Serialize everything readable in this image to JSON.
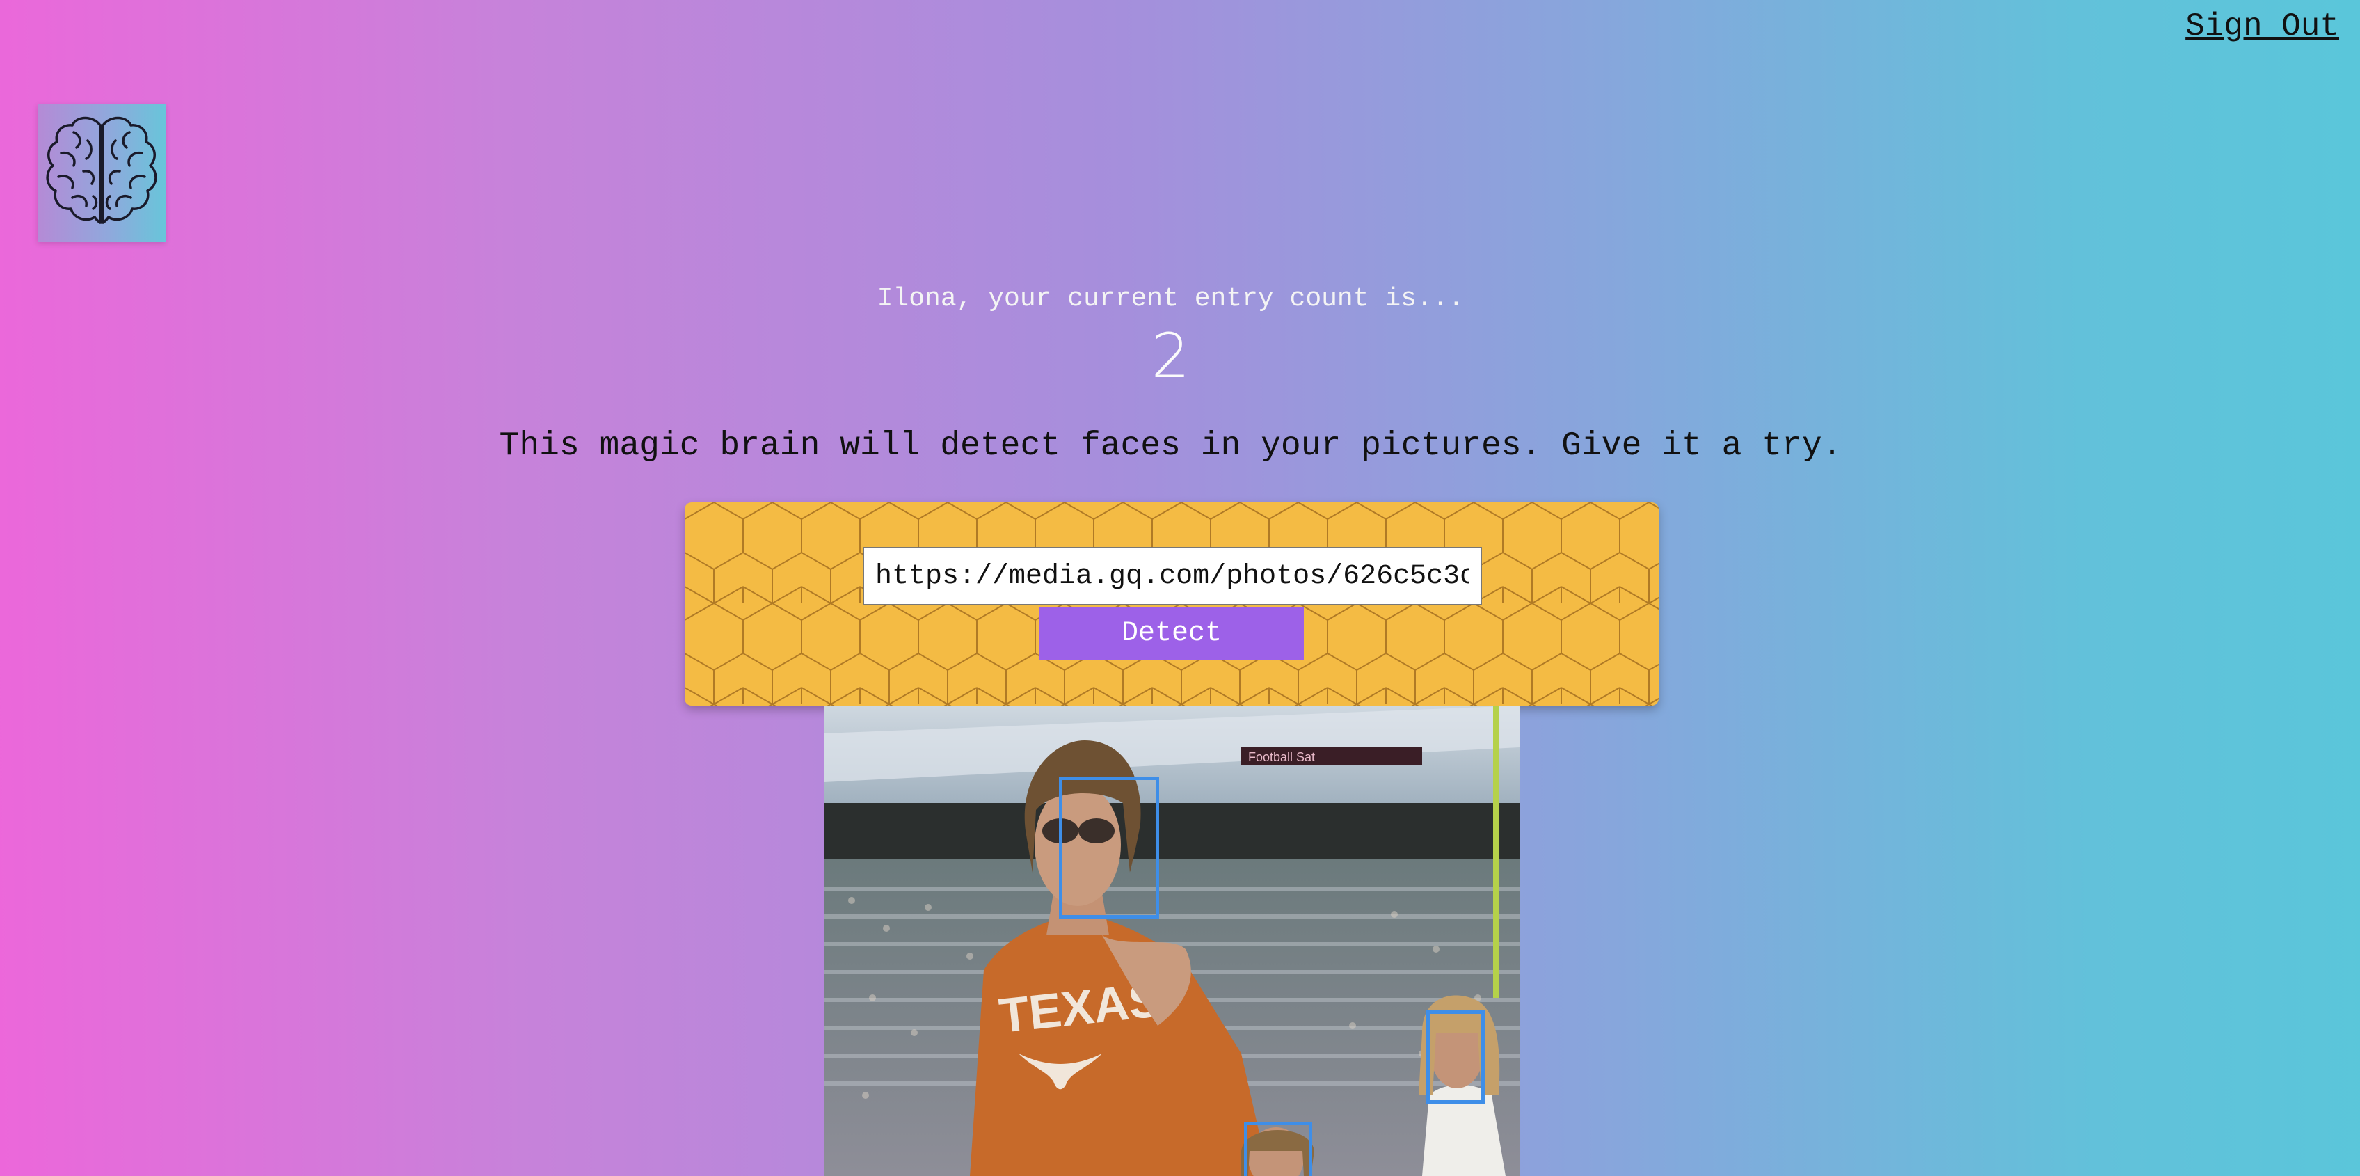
{
  "nav": {
    "signout_label": "Sign Out"
  },
  "logo": {
    "icon": "brain-icon"
  },
  "rank": {
    "greeting": "Ilona, your current entry count is...",
    "count": "2"
  },
  "tagline": "This magic brain will detect faces in your pictures. Give it a try.",
  "form": {
    "input_value": "https://media.gq.com/photos/626c5c3c",
    "button_label": "Detect"
  },
  "image": {
    "description_icon": "detected-image",
    "shirt_text": "TEXAS"
  },
  "colors": {
    "gradient_left": "#ec67da",
    "gradient_right": "#5ac6da",
    "panel": "#f4bb44",
    "button": "#9d61e8",
    "box": "#3e8ee8"
  }
}
